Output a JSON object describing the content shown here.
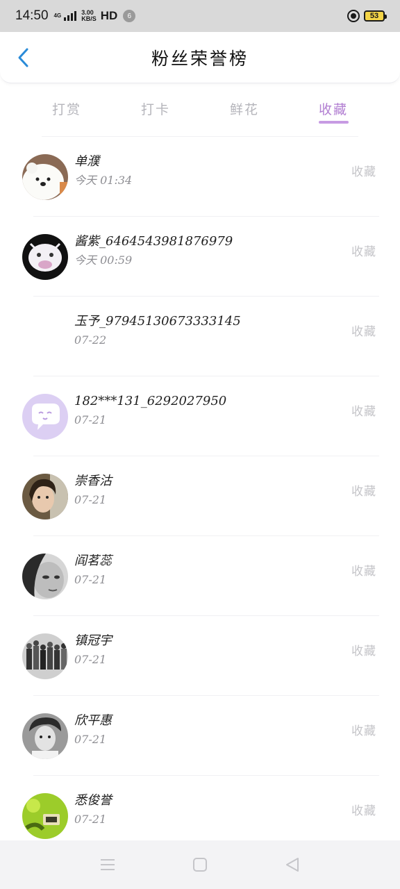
{
  "status_bar": {
    "time": "14:50",
    "net_type": "4G",
    "speed_value": "3.00",
    "speed_unit": "KB/S",
    "hd": "HD",
    "notification_count": "6",
    "battery": "53"
  },
  "header": {
    "title": "粉丝荣誉榜",
    "back_icon": "chevron-left-icon"
  },
  "tabs": [
    {
      "label": "打赏",
      "active": false
    },
    {
      "label": "打卡",
      "active": false
    },
    {
      "label": "鲜花",
      "active": false
    },
    {
      "label": "收藏",
      "active": true
    }
  ],
  "accent_color": "#b27fd2",
  "list": [
    {
      "name": "单濮",
      "time": "今天 01:34",
      "action": "收藏",
      "avatar": "polar-bear-avatar"
    },
    {
      "name": "酱紫_6464543981876979",
      "time": "今天 00:59",
      "action": "收藏",
      "avatar": "cartoon-avatar"
    },
    {
      "name": "玉予_97945130673333145",
      "time": "07-22",
      "action": "收藏",
      "avatar": "blank-avatar"
    },
    {
      "name": "182***131_6292027950",
      "time": "07-21",
      "action": "收藏",
      "avatar": "default-purple-avatar"
    },
    {
      "name": "崇香沽",
      "time": "07-21",
      "action": "收藏",
      "avatar": "photo-avatar"
    },
    {
      "name": "阎茗蕊",
      "time": "07-21",
      "action": "收藏",
      "avatar": "photo-avatar"
    },
    {
      "name": "镇冠宇",
      "time": "07-21",
      "action": "收藏",
      "avatar": "group-photo-avatar"
    },
    {
      "name": "欣平惠",
      "time": "07-21",
      "action": "收藏",
      "avatar": "photo-avatar"
    },
    {
      "name": "悉俊誉",
      "time": "07-21",
      "action": "收藏",
      "avatar": "green-photo-avatar"
    }
  ],
  "nav_bar": {
    "menu_icon": "menu-icon",
    "home_icon": "home-square-icon",
    "back_icon": "back-triangle-icon"
  }
}
